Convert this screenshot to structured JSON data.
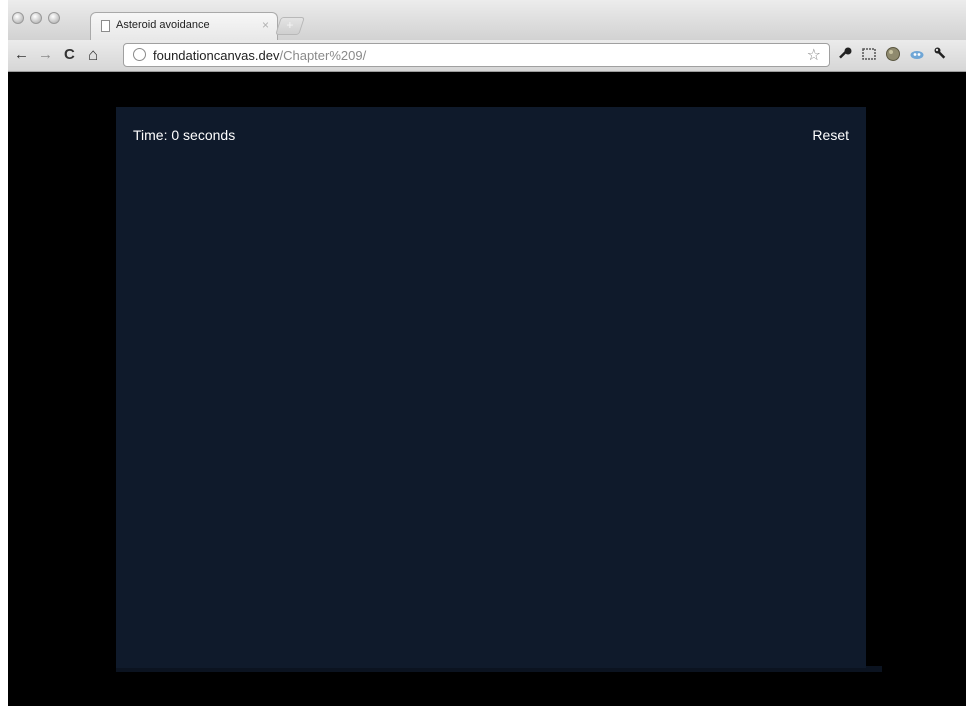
{
  "browser": {
    "tab": {
      "title": "Asteroid avoidance",
      "close_icon": "close-icon",
      "close_glyph": "×"
    },
    "new_tab_glyph": "+",
    "toolbar": {
      "back_glyph": "←",
      "forward_glyph": "→",
      "reload_glyph": "C",
      "home_glyph": "⌂",
      "icons": [
        "star-icon",
        "key-icon",
        "screenshot-icon",
        "extension-globe-icon",
        "extension-cloud-icon",
        "wrench-icon"
      ]
    },
    "address": {
      "host": "foundationcanvas.dev",
      "path": "/Chapter%209/"
    }
  },
  "game": {
    "time_label": "Time: 0 seconds",
    "reset_label": "Reset",
    "background_color": "#0f1a2b"
  },
  "colors": {
    "page_background": "#000000",
    "text": "#ffffff"
  }
}
